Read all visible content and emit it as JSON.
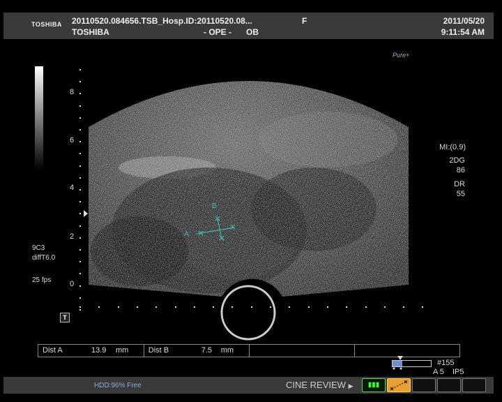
{
  "header": {
    "brand_logo": "TOSHIBA",
    "file_info": "20110520.084656.TSB_Hosp.ID:20110520.08...",
    "sex": "F",
    "date": "2011/05/20",
    "brand": "TOSHIBA",
    "mode_ope": "- OPE -",
    "mode_ob": "OB",
    "time": "9:11:54 AM"
  },
  "pure_logo": "Pure+",
  "depth_scale": {
    "labels": [
      "8",
      "6",
      "4",
      "2",
      "0"
    ]
  },
  "left_info": {
    "probe": "9C3",
    "preset": "diffT6.0",
    "fps": "25 fps"
  },
  "right_info": {
    "mi": "MI:(0.9)",
    "gain_label": "2DG",
    "gain_value": "86",
    "dr_label": "DR",
    "dr_value": "55"
  },
  "calipers": {
    "a_label": "A",
    "b_label": "B"
  },
  "t_icon": "T",
  "measurements": {
    "dist_a_label": "Dist A",
    "dist_a_value": "13.9",
    "dist_a_unit": "mm",
    "dist_b_label": "Dist B",
    "dist_b_value": "7.5",
    "dist_b_unit": "mm"
  },
  "cine_info": {
    "frame_fraction": 0.25,
    "frame_number": "#155",
    "sub_a": "A 5",
    "sub_ip": "IP5"
  },
  "bottom": {
    "hdd": "HDD:96% Free",
    "cine_review": "CINE REVIEW",
    "play_icon": "▶"
  },
  "colors": {
    "caliper": "#3fb8b0",
    "header_bg": "#3a3a3a",
    "frame_fill": "#6f8fd8"
  }
}
